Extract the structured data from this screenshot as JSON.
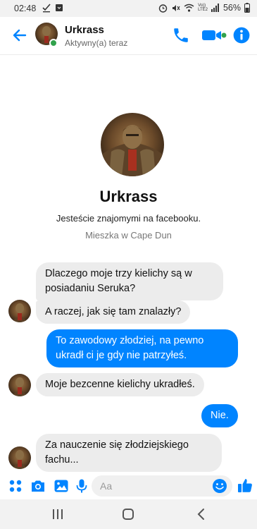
{
  "status_bar": {
    "time": "02:48",
    "volte": "Vo))\nLTE2",
    "battery": "56%"
  },
  "header": {
    "name": "Urkrass",
    "status": "Aktywny(a) teraz"
  },
  "profile": {
    "name": "Urkrass",
    "friends_text": "Jesteście znajomymi na facebooku.",
    "location_text": "Mieszka w Cape Dun"
  },
  "messages": [
    {
      "from": "them",
      "text": "Dlaczego moje trzy kielichy są w posiadaniu Seruka?"
    },
    {
      "from": "them",
      "text": "A raczej, jak się tam znalazły?"
    },
    {
      "from": "me",
      "text": "To zawodowy złodziej, na pewno ukradł ci je gdy nie patrzyłeś."
    },
    {
      "from": "them",
      "text": "Moje bezcenne kielichy ukradłeś."
    },
    {
      "from": "me",
      "text": "Nie."
    },
    {
      "from": "them",
      "text": "Za nauczenie się złodziejskiego fachu..."
    }
  ],
  "composer": {
    "placeholder": "Aa"
  },
  "colors": {
    "accent": "#0084ff",
    "online": "#31a24c",
    "incoming_bubble": "#ececec"
  },
  "icons": [
    "back-arrow-icon",
    "phone-icon",
    "video-camera-icon",
    "info-icon",
    "apps-grid-icon",
    "camera-icon",
    "gallery-icon",
    "microphone-icon",
    "emoji-icon",
    "thumbs-up-icon"
  ]
}
